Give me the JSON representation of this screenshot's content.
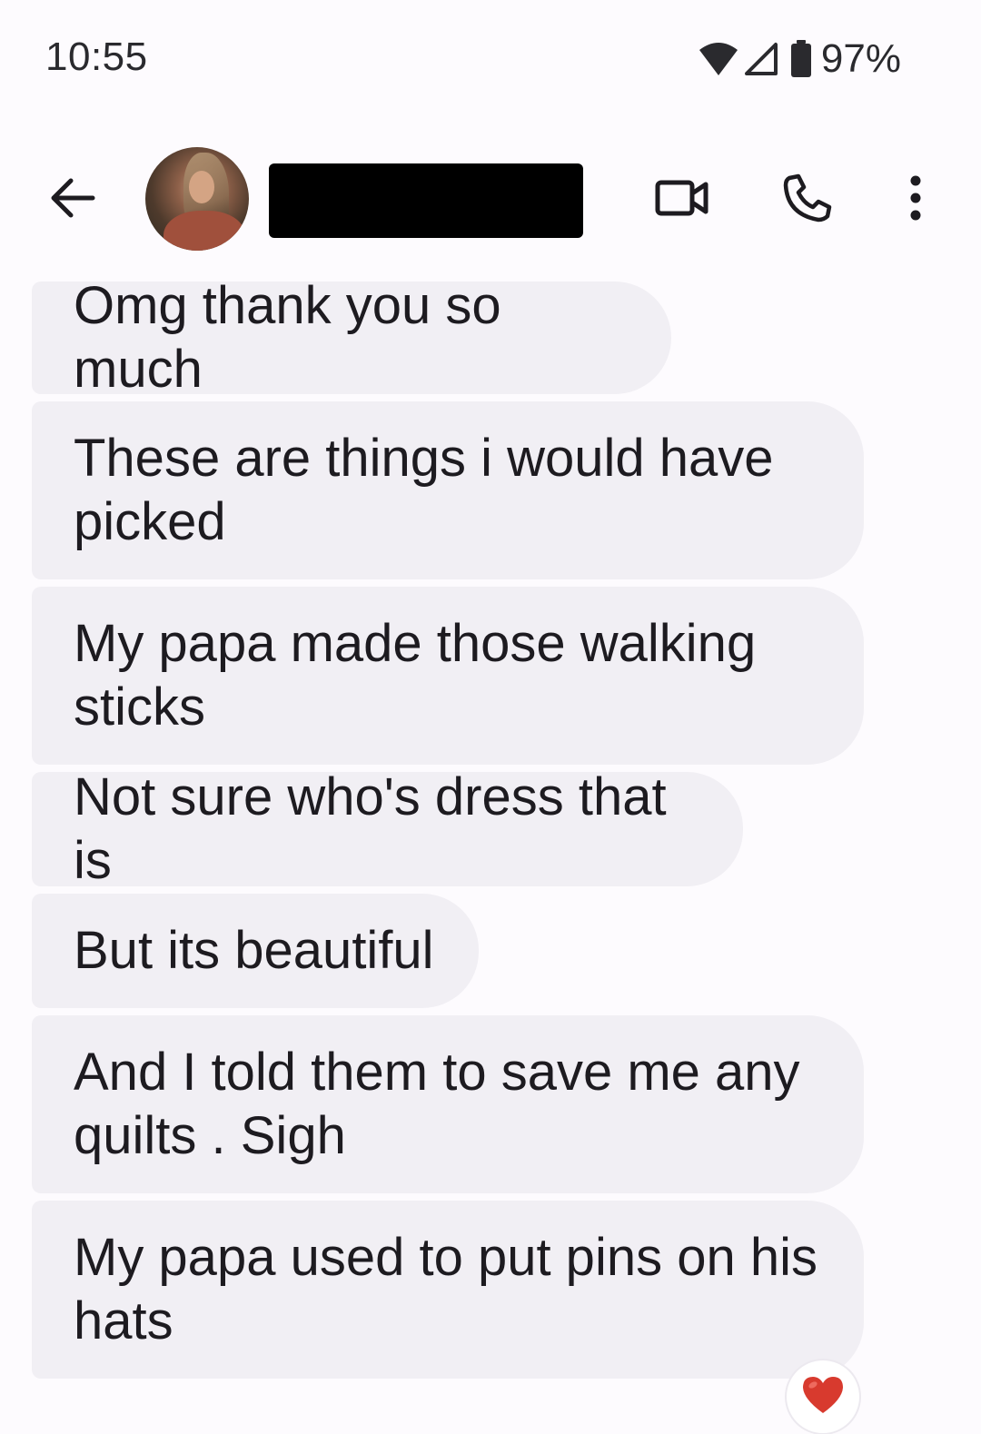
{
  "status_bar": {
    "time": "10:55",
    "battery_percent": "97%"
  },
  "app_bar": {
    "contact_name": "",
    "back_icon": "arrow-left-icon",
    "video_icon": "video-camera-icon",
    "call_icon": "phone-icon",
    "more_icon": "more-vertical-icon"
  },
  "messages": [
    {
      "text": "Omg thank you so much"
    },
    {
      "text": "These are things i would have picked"
    },
    {
      "text": "My papa made those walking sticks"
    },
    {
      "text": "Not sure who's dress that is"
    },
    {
      "text": "But its beautiful"
    },
    {
      "text": "And I told them to save me any quilts . Sigh"
    },
    {
      "text": "My papa used to put pins on his hats"
    }
  ],
  "reaction": {
    "emoji": "❤️",
    "icon": "heart-icon"
  },
  "colors": {
    "background": "#fdfbfe",
    "bubble": "#f1eff4",
    "text": "#1d1b20",
    "heart": "#d83a2e"
  }
}
